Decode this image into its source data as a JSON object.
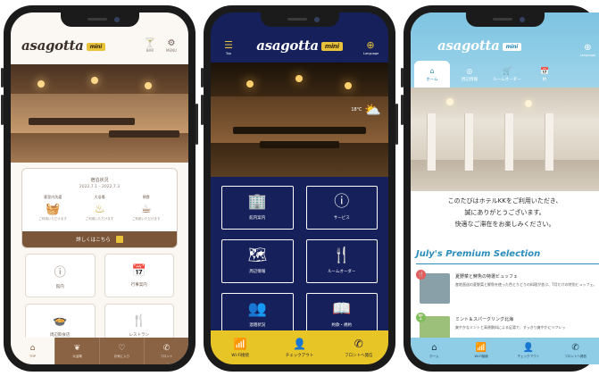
{
  "phone1": {
    "brand": "asagotta",
    "brand_badge": "mini",
    "header_icons": [
      {
        "icon": "cocktail-icon",
        "glyph": "🍸",
        "label": "BAR"
      },
      {
        "icon": "settings-icon",
        "glyph": "⚙",
        "label": "MENU"
      }
    ],
    "card": {
      "title": "宿泊状況",
      "date": "2022.7.1 – 2022.7.3",
      "items": [
        {
          "label": "客室内洗濯",
          "glyph": "🧺",
          "sub": "ご利用いただけます"
        },
        {
          "label": "大浴場",
          "glyph": "♨",
          "sub": "ご利用いただけます"
        },
        {
          "label": "朝食",
          "glyph": "☕",
          "sub": "ご利用いただけます"
        }
      ],
      "cta": "詳しくはこちら"
    },
    "tiles": [
      {
        "icon": "info-icon",
        "glyph": "ⓘ",
        "label": "館内"
      },
      {
        "icon": "calendar-icon",
        "glyph": "📅",
        "label": "行事案内"
      },
      {
        "icon": "dish-icon",
        "glyph": "🍲",
        "label": "周辺飲食店"
      },
      {
        "icon": "restaurant-icon",
        "glyph": "🍴",
        "label": "レストラン"
      }
    ],
    "nav": [
      {
        "icon": "home-icon",
        "glyph": "⌂",
        "label": "TOP"
      },
      {
        "icon": "spa-icon",
        "glyph": "❦",
        "label": "大浴場"
      },
      {
        "icon": "heart-icon",
        "glyph": "♡",
        "label": "お気に入り"
      },
      {
        "icon": "phone-icon",
        "glyph": "✆",
        "label": "フロント"
      }
    ]
  },
  "phone2": {
    "brand": "asagotta",
    "brand_badge": "mini",
    "left_btn": {
      "icon": "top-menu-icon",
      "glyph": "☰",
      "label": "Top"
    },
    "right_btn": {
      "icon": "globe-icon",
      "glyph": "⊕",
      "label": "Language"
    },
    "weather": {
      "temp": "18℃",
      "icon": "partly-cloudy-icon",
      "glyph": "⛅"
    },
    "tiles": [
      {
        "icon": "building-icon",
        "glyph": "🏢",
        "label": "館内案内"
      },
      {
        "icon": "info-icon",
        "glyph": "ⓘ",
        "label": "サービス"
      },
      {
        "icon": "map-pin-icon",
        "glyph": "🗺",
        "label": "周辺情報"
      },
      {
        "icon": "fork-knife-icon",
        "glyph": "🍴",
        "label": "ルームオーダー"
      },
      {
        "icon": "people-icon",
        "glyph": "👥",
        "label": "混雑状況"
      },
      {
        "icon": "book-icon",
        "glyph": "📖",
        "label": "約款・規約"
      }
    ],
    "nav": [
      {
        "icon": "wifi-icon",
        "glyph": "📶",
        "label": "Wi-Fi接続"
      },
      {
        "icon": "checkout-icon",
        "glyph": "👤",
        "label": "チェックアウト"
      },
      {
        "icon": "phone-icon",
        "glyph": "✆",
        "label": "フロントへ発信"
      }
    ]
  },
  "phone3": {
    "brand": "asagotta",
    "brand_badge": "mini",
    "lang": {
      "icon": "globe-icon",
      "glyph": "⊕",
      "label": "Language"
    },
    "tabs": [
      {
        "icon": "home-icon",
        "glyph": "⌂",
        "label": "ホーム",
        "active": true
      },
      {
        "icon": "map-pin-icon",
        "glyph": "◎",
        "label": "周辺情報",
        "active": false
      },
      {
        "icon": "cart-icon",
        "glyph": "🛒",
        "label": "ルームオーダー",
        "active": false
      },
      {
        "icon": "calendar-icon",
        "glyph": "📅",
        "label": "約",
        "active": false
      }
    ],
    "greeting": [
      "このたびはホテルKKをご利用いただき、",
      "誠にありがとうございます。",
      "快適なご滞在をお楽しみください。"
    ],
    "selection_title": "July's Premium Selection",
    "cards": [
      {
        "badge_icon": "fork-knife-icon",
        "badge_glyph": "🍴",
        "badge_color": "#e45c5c",
        "thumb_color": "#8aa0a8",
        "title": "夏野菜と鮮魚の特選ビュッフェ",
        "desc": "産地直送の夏野菜と鮮魚を使った色とりどりの料理が並ぶ、7月だけの特別ビュッフェ。"
      },
      {
        "badge_icon": "cocktail-icon",
        "badge_glyph": "🍸",
        "badge_color": "#7fbf5a",
        "thumb_color": "#9cbf7a",
        "title": "ミント＆スパークリング北海",
        "desc": "爽やかなミントと高原飲料による足湯で、すっきり爽やかにリフレッ"
      }
    ],
    "nav": [
      {
        "icon": "home-icon",
        "glyph": "⌂",
        "label": "ホーム"
      },
      {
        "icon": "wifi-icon",
        "glyph": "📶",
        "label": "Wi-Fi接続"
      },
      {
        "icon": "checkout-icon",
        "glyph": "👤",
        "label": "チェックアウト"
      },
      {
        "icon": "phone-icon",
        "glyph": "✆",
        "label": "フロントへ発信"
      }
    ]
  }
}
